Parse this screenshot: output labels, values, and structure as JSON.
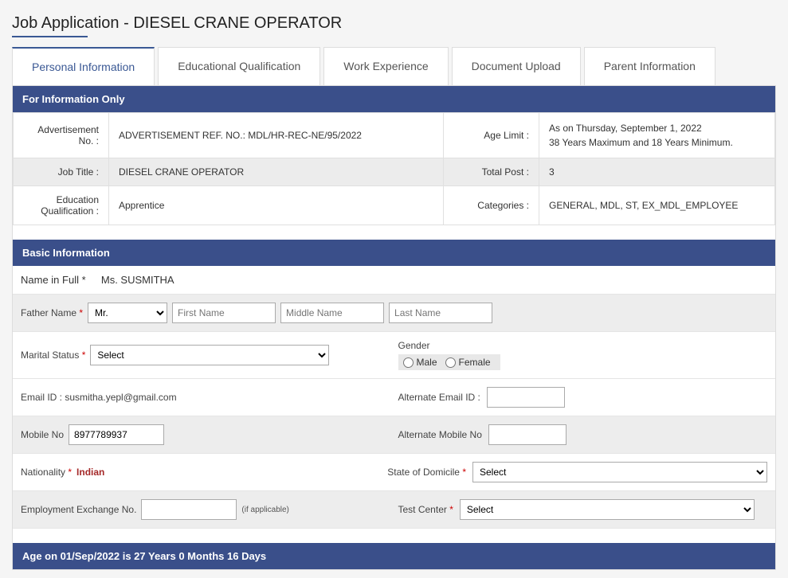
{
  "page_title": "Job Application - DIESEL CRANE OPERATOR",
  "tabs": {
    "personal": "Personal Information",
    "education": "Educational Qualification",
    "work": "Work Experience",
    "document": "Document Upload",
    "parent": "Parent Information"
  },
  "info_section_title": "For Information Only",
  "info": {
    "adv_no_label": "Advertisement No. :",
    "adv_no_value": "ADVERTISEMENT REF. NO.: MDL/HR-REC-NE/95/2022",
    "age_limit_label": "Age Limit :",
    "age_limit_value_line1": "As on Thursday, September 1, 2022",
    "age_limit_value_line2": "38 Years Maximum and 18 Years Minimum.",
    "job_title_label": "Job Title :",
    "job_title_value": "DIESEL CRANE OPERATOR",
    "total_post_label": "Total Post :",
    "total_post_value": "3",
    "edu_label": "Education Qualification :",
    "edu_value": "Apprentice",
    "categories_label": "Categories :",
    "categories_value": "GENERAL, MDL, ST, EX_MDL_EMPLOYEE"
  },
  "basic_section_title": "Basic Information",
  "basic": {
    "name_full_label": "Name in Full *",
    "name_full_value": "Ms.   SUSMITHA",
    "father_name_label": "Father Name ",
    "salutation_option": "Mr.",
    "first_name_ph": "First Name",
    "middle_name_ph": "Middle Name",
    "last_name_ph": "Last Name",
    "marital_label": "Marital Status ",
    "marital_option": "Select",
    "gender_label": "Gender",
    "gender_male": "Male",
    "gender_female": "Female",
    "email_label": "Email ID : susmitha.yepl@gmail.com",
    "alt_email_label": "Alternate Email ID :",
    "mobile_label": "Mobile No ",
    "mobile_value": "8977789937",
    "alt_mobile_label": "Alternate Mobile No ",
    "nationality_label": "Nationality ",
    "nationality_value": "Indian",
    "domicile_label": "State of Domicile ",
    "domicile_option": "Select",
    "empex_label": "Employment Exchange No. ",
    "empex_note": "(if applicable)",
    "testcenter_label": "Test Center ",
    "testcenter_option": "Select"
  },
  "age_section_title": "Age on 01/Sep/2022 is 27 Years 0 Months 16 Days"
}
